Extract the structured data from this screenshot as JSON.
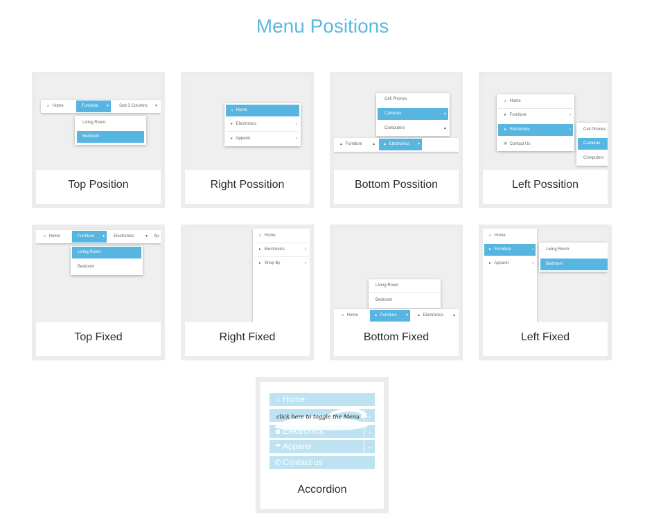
{
  "page": {
    "title": "Menu Positions"
  },
  "cards": [
    {
      "label": "Top Position"
    },
    {
      "label": "Right Possition"
    },
    {
      "label": "Bottom Possition"
    },
    {
      "label": "Left Possition"
    },
    {
      "label": "Top Fixed"
    },
    {
      "label": "Right Fixed"
    },
    {
      "label": "Bottom Fixed"
    },
    {
      "label": "Left Fixed"
    }
  ],
  "thumbs": {
    "top_position": {
      "home": "Home",
      "furniture": "Furniture",
      "sub": "Sub 3 Columns",
      "living": "Living Room",
      "bedroom": "Bedroom"
    },
    "right_position": {
      "home": "Home",
      "electronics": "Electronics",
      "apparel": "Apparel"
    },
    "bottom_position": {
      "cell": "Cell Phones",
      "cameras": "Cameras",
      "computers": "Computers",
      "furniture": "Furniture",
      "electronics": "Electronics"
    },
    "left_position": {
      "home": "Home",
      "furniture": "Furniture",
      "electronics": "Electronics",
      "contact": "Contact Us",
      "cell": "Cell Phones",
      "cameras": "Cameras",
      "computers": "Computers"
    },
    "top_fixed": {
      "home": "Home",
      "furniture": "Furniture",
      "electronics": "Electronics",
      "ap": "Ap",
      "living": "Living Room",
      "bedroom": "Bedroom"
    },
    "right_fixed": {
      "home": "Home",
      "electronics": "Electronics",
      "shop": "Shop By"
    },
    "bottom_fixed": {
      "living": "Living Room",
      "bedroom": "Bedroom",
      "home": "Home",
      "furniture": "Furniture",
      "electronics": "Electronics"
    },
    "left_fixed": {
      "home": "Home",
      "furniture": "Furniture",
      "apparel": "Apparel",
      "living": "Living Room",
      "bedroom": "Bedroom"
    }
  },
  "accordion": {
    "label": "Accordion",
    "items": [
      "Home",
      "",
      "Electronics",
      "Apparel",
      "Contact us"
    ],
    "hint": "click here to toggle the Menu"
  },
  "icons": {
    "home": "home-icon",
    "caret_right": "caret-right-icon",
    "caret_left": "caret-left-icon",
    "caret_up": "caret-up-icon",
    "envelope": "envelope-icon",
    "camera": "camera-icon",
    "umbrella": "umbrella-icon",
    "phone": "phone-icon",
    "chevron_down": "chevron-down-icon"
  },
  "colors": {
    "accent": "#57b6e1",
    "title": "#5ab9e0",
    "card_border": "#ececec",
    "accordion_bg": "#bde2f2"
  }
}
